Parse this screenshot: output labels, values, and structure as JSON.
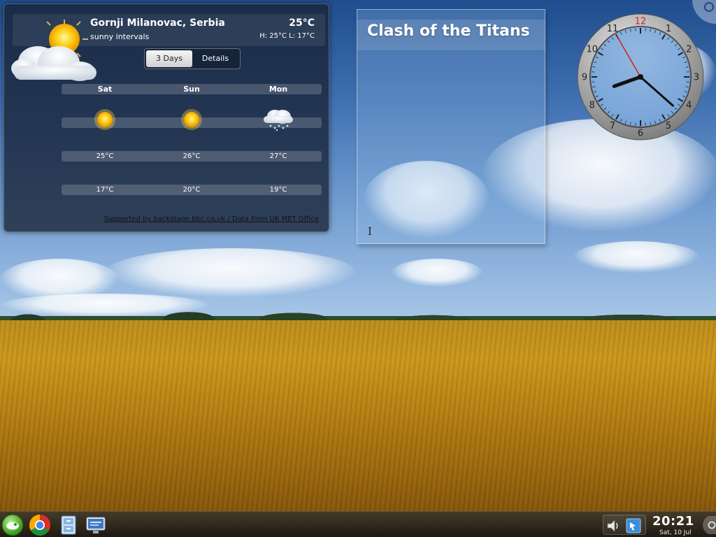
{
  "weather": {
    "location": "Gornji Milanovac, Serbia",
    "condition": "sunny intervals",
    "temperature": "25°C",
    "high_low": "H: 25°C L: 17°C",
    "tabs": [
      {
        "label": "3 Days",
        "active": true
      },
      {
        "label": "Details",
        "active": false
      }
    ],
    "days": [
      {
        "name": "Sat",
        "icon": "sun-icon",
        "high": "25°C",
        "low": "17°C"
      },
      {
        "name": "Sun",
        "icon": "sun-icon",
        "high": "26°C",
        "low": "20°C"
      },
      {
        "name": "Mon",
        "icon": "cloud-snow-icon",
        "high": "27°C",
        "low": "19°C"
      }
    ],
    "credits": "Supported by backstage.bbc.co.uk / Data from UK MET Office"
  },
  "note": {
    "title": "Clash of the Titans",
    "cursor_glyph": "I"
  },
  "analog_clock": {
    "numerals": [
      "12",
      "1",
      "2",
      "3",
      "4",
      "5",
      "6",
      "7",
      "8",
      "9",
      "10",
      "11"
    ],
    "hour": 8,
    "minute": 21,
    "second": 55,
    "accent_color": "#cc2222"
  },
  "panel": {
    "launchers": [
      "kickoff-menu-icon",
      "chrome-browser-icon",
      "file-manager-icon",
      "show-desktop-icon"
    ],
    "tray": [
      "volume-icon",
      "network-icon"
    ],
    "time": "20:21",
    "date": "Sat, 10 Jul"
  }
}
